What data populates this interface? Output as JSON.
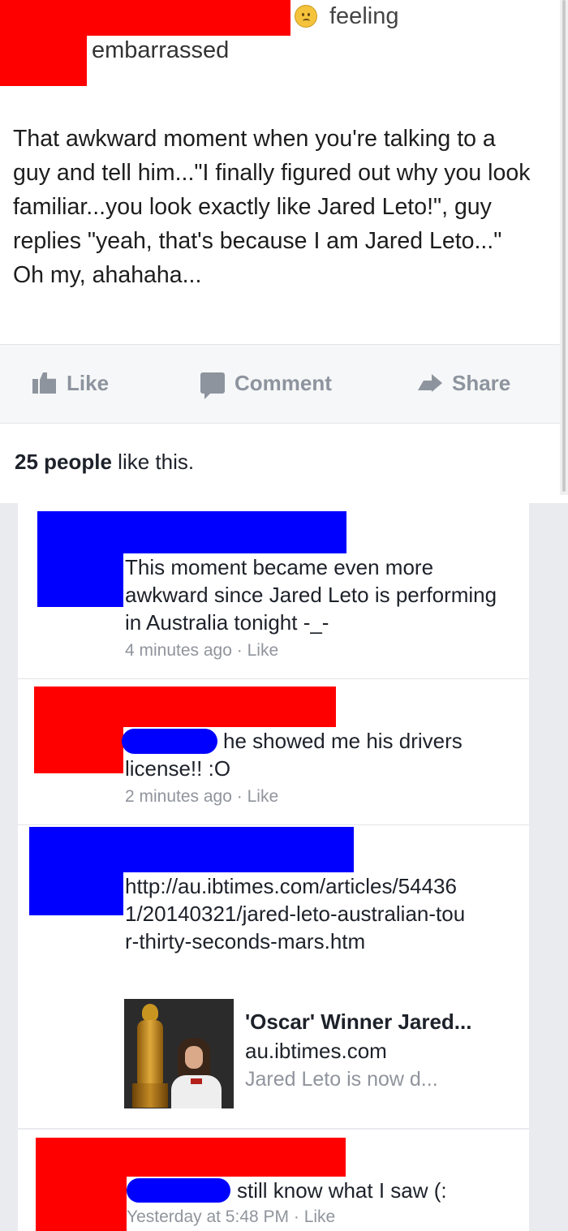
{
  "post": {
    "feeling_word": "feeling",
    "feeling_value": "embarrassed",
    "text": "That awkward moment when you're talking to a guy and tell him...\"I finally figured out why you look familiar...you look exactly like Jared Leto!\", guy replies \"yeah, that's because I am Jared Leto...\" Oh my, ahahaha..."
  },
  "actions": {
    "like": "Like",
    "comment": "Comment",
    "share": "Share"
  },
  "likes": {
    "count": "25 people",
    "suffix": " like this."
  },
  "comments": [
    {
      "text": "This moment became even more awkward since Jared Leto is performing in Australia tonight -_-",
      "time": "4 minutes ago",
      "like": "Like"
    },
    {
      "text_after_tag": "he showed me his drivers",
      "text_line2": "license!! :O",
      "time": "2 minutes ago",
      "like": "Like"
    },
    {
      "link": "http://au.ibtimes.com/articles/544361/20140321/jared-leto-australian-tour-thirty-seconds-mars.htm",
      "preview": {
        "title": "'Oscar' Winner Jared...",
        "domain": "au.ibtimes.com",
        "snippet": "Jared Leto is now d..."
      }
    },
    {
      "text_after_tag": "still know what I saw (:",
      "time": "Yesterday at 5:48 PM",
      "like": "Like"
    }
  ],
  "icons": {
    "feeling": "sad-face-emoji-icon",
    "like": "thumbs-up-icon",
    "comment": "comment-bubble-icon",
    "share": "share-arrow-icon"
  },
  "colors": {
    "redaction_red": "#ff0000",
    "redaction_blue": "#0000ff",
    "action_gray": "#8d949e",
    "meta_gray": "#90949c"
  }
}
